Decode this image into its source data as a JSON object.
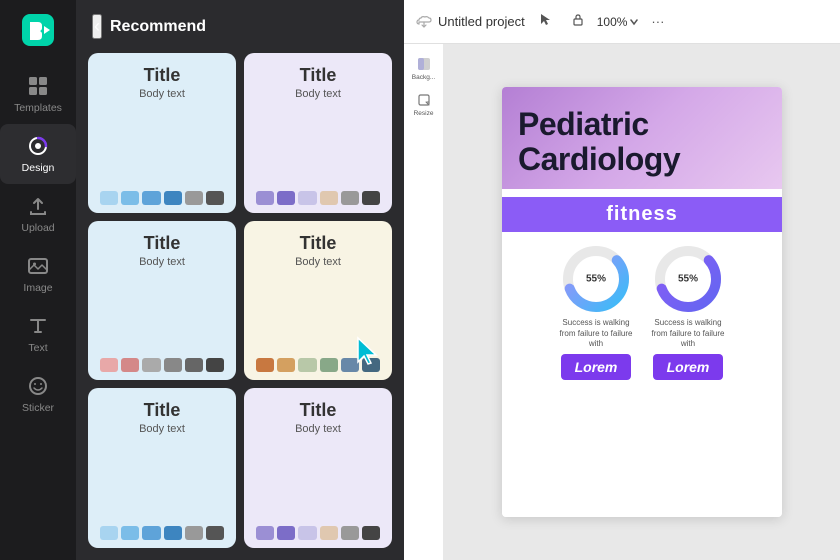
{
  "sidebar": {
    "logo_label": "CapCut",
    "items": [
      {
        "id": "templates",
        "label": "Templates",
        "icon": "template-icon"
      },
      {
        "id": "design",
        "label": "Design",
        "icon": "design-icon",
        "active": true
      },
      {
        "id": "upload",
        "label": "Upload",
        "icon": "upload-icon"
      },
      {
        "id": "image",
        "label": "Image",
        "icon": "image-icon"
      },
      {
        "id": "text",
        "label": "Text",
        "icon": "text-icon"
      },
      {
        "id": "sticker",
        "label": "Sticker",
        "icon": "sticker-icon"
      }
    ]
  },
  "panel": {
    "back_label": "‹",
    "title": "Recommend",
    "cards": [
      {
        "id": 1,
        "title": "Title",
        "body": "Body text",
        "bg": "#ddeef8",
        "swatches": [
          "#a8d4f0",
          "#7bbde8",
          "#5ea3d9",
          "#3d85c0",
          "#888",
          "#555"
        ]
      },
      {
        "id": 2,
        "title": "Title",
        "body": "Body text",
        "bg": "#ece8f8",
        "swatches": [
          "#9b8fd4",
          "#7c6dc8",
          "#c8c4e8",
          "#e0c8b0",
          "#888",
          "#444"
        ]
      },
      {
        "id": 3,
        "title": "Title",
        "body": "Body text",
        "bg": "#ddeef8",
        "swatches": [
          "#e8a8a8",
          "#d48888",
          "#aaaaaa",
          "#888888",
          "#666666",
          "#444444"
        ]
      },
      {
        "id": 4,
        "title": "Title",
        "body": "Body text",
        "bg": "#f8f4e4",
        "swatches": [
          "#c87840",
          "#d4a060",
          "#b8c8a8",
          "#88a888",
          "#6888a8",
          "#446880"
        ]
      },
      {
        "id": 5,
        "title": "Title",
        "body": "Body text",
        "bg": "#ddeef8",
        "swatches": [
          "#a8d4f0",
          "#7bbde8",
          "#5ea3d9",
          "#3d85c0",
          "#888",
          "#555"
        ]
      },
      {
        "id": 6,
        "title": "Title",
        "body": "Body text",
        "bg": "#ece8f8",
        "swatches": [
          "#9b8fd4",
          "#7c6dc8",
          "#c8c4e8",
          "#e0c8b0",
          "#888",
          "#444"
        ]
      }
    ]
  },
  "canvas": {
    "project_title": "Untitled project",
    "zoom_level": "100%",
    "zoom_label": "100%",
    "slide": {
      "main_title_line1": "Pediatric",
      "main_title_line2": "Cardiology",
      "banner_text": "fitness",
      "chart1_pct": "55%",
      "chart2_pct": "55%",
      "chart_desc": "Success is walking from failure to failure with",
      "lorem_label": "Lorem"
    }
  },
  "tools": {
    "background_label": "Backg...",
    "resize_label": "Resize"
  }
}
